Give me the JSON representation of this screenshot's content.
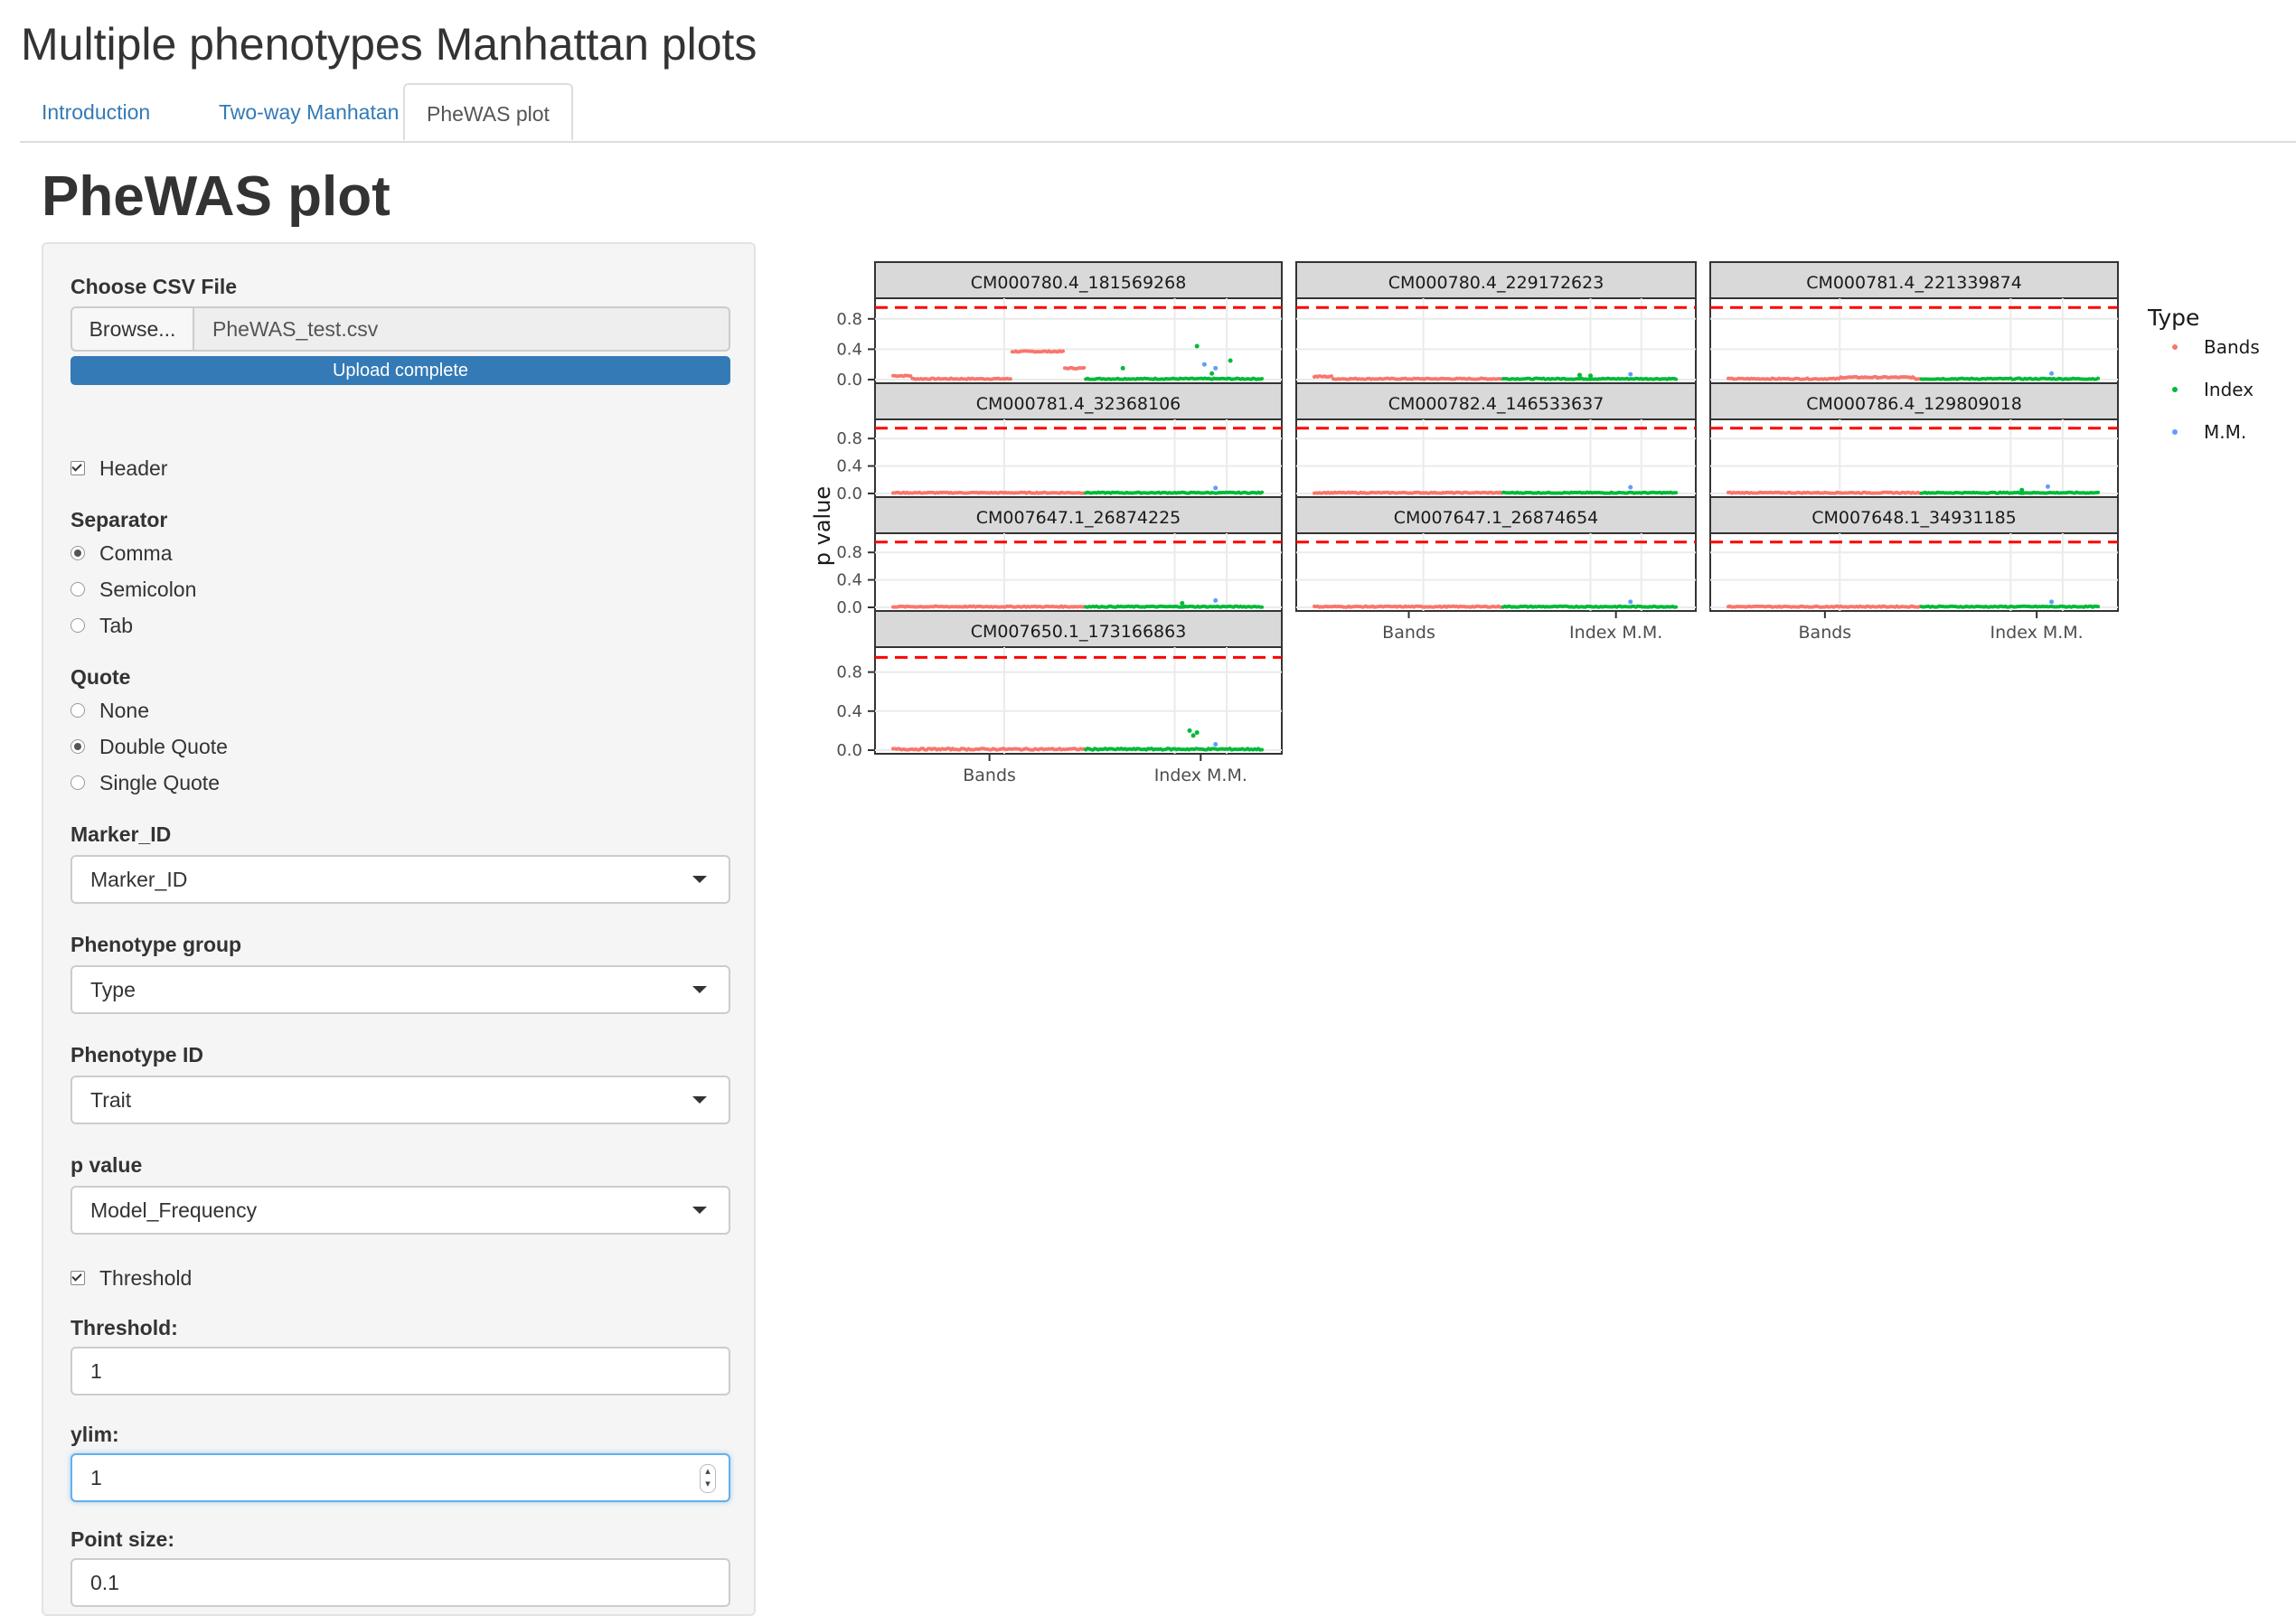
{
  "app": {
    "title": "Multiple phenotypes Manhattan plots",
    "tabs": [
      {
        "label": "Introduction",
        "active": false
      },
      {
        "label": "Two-way Manhatan",
        "active": false
      },
      {
        "label": "PheWAS plot",
        "active": true
      }
    ]
  },
  "page": {
    "title": "PheWAS plot"
  },
  "sidebar": {
    "file": {
      "label": "Choose CSV File",
      "browse_label": "Browse...",
      "file_name": "PheWAS_test.csv",
      "progress_text": "Upload complete",
      "progress": 1.0
    },
    "header_checkbox": {
      "label": "Header",
      "checked": true
    },
    "separator": {
      "label": "Separator",
      "options": [
        {
          "label": "Comma",
          "selected": true
        },
        {
          "label": "Semicolon",
          "selected": false
        },
        {
          "label": "Tab",
          "selected": false
        }
      ]
    },
    "quote": {
      "label": "Quote",
      "options": [
        {
          "label": "None",
          "selected": false
        },
        {
          "label": "Double Quote",
          "selected": true
        },
        {
          "label": "Single Quote",
          "selected": false
        }
      ]
    },
    "marker_id": {
      "label": "Marker_ID",
      "value": "Marker_ID"
    },
    "phenotype_group": {
      "label": "Phenotype group",
      "value": "Type"
    },
    "phenotype_id": {
      "label": "Phenotype ID",
      "value": "Trait"
    },
    "p_value": {
      "label": "p value",
      "value": "Model_Frequency"
    },
    "threshold_checkbox": {
      "label": "Threshold",
      "checked": true
    },
    "threshold": {
      "label": "Threshold:",
      "value": "1"
    },
    "ylim": {
      "label": "ylim:",
      "value": "1"
    },
    "point_size": {
      "label": "Point size:",
      "value": "0.1"
    }
  },
  "colors": {
    "accent": "#337ab7",
    "bands": "#F8766D",
    "index": "#00BA38",
    "mm": "#619CFF",
    "threshold_line": "#FF0000",
    "strip_bg": "#D9D9D9"
  },
  "chart_data": {
    "type": "scatter",
    "title": "",
    "xlabel": "",
    "ylabel": "p value",
    "y_ticks": [
      "0.0",
      "0.4",
      "0.8"
    ],
    "ylim": [
      0,
      1
    ],
    "threshold": 0.95,
    "x_categories": [
      "Bands",
      "Index",
      "M.M."
    ],
    "x_tick_labels": [
      "Bands",
      "Index M.M."
    ],
    "legend": {
      "title": "Type",
      "position": "right",
      "entries": [
        "Bands",
        "Index",
        "M.M."
      ]
    },
    "grid": true,
    "panels": [
      {
        "title": "CM000780.4_181569268",
        "series": [
          {
            "name": "Bands",
            "baseline": 0.01,
            "bumps": [
              {
                "from": 0.0,
                "to": 0.05,
                "value": 0.05
              },
              {
                "from": 0.32,
                "to": 0.46,
                "value": 0.37
              },
              {
                "from": 0.46,
                "to": 0.52,
                "value": 0.15
              }
            ]
          },
          {
            "name": "Index",
            "baseline": 0.01,
            "outliers": [
              [
                0.62,
                0.15
              ],
              [
                0.82,
                0.44
              ],
              [
                0.91,
                0.25
              ],
              [
                0.86,
                0.08
              ]
            ]
          },
          {
            "name": "M.M.",
            "outliers": [
              [
                0.84,
                0.2
              ],
              [
                0.87,
                0.15
              ]
            ]
          }
        ]
      },
      {
        "title": "CM000780.4_229172623",
        "series": [
          {
            "name": "Bands",
            "baseline": 0.01,
            "bumps": [
              {
                "from": 0.0,
                "to": 0.05,
                "value": 0.04
              }
            ]
          },
          {
            "name": "Index",
            "baseline": 0.01,
            "outliers": [
              [
                0.73,
                0.06
              ],
              [
                0.76,
                0.05
              ]
            ]
          },
          {
            "name": "M.M.",
            "outliers": [
              [
                0.87,
                0.07
              ]
            ]
          }
        ]
      },
      {
        "title": "CM000781.4_221339874",
        "series": [
          {
            "name": "Bands",
            "baseline": 0.01,
            "bumps": [
              {
                "from": 0.3,
                "to": 0.5,
                "value": 0.03
              }
            ]
          },
          {
            "name": "Index",
            "baseline": 0.01,
            "outliers": []
          },
          {
            "name": "M.M.",
            "outliers": [
              [
                0.87,
                0.08
              ]
            ]
          }
        ]
      },
      {
        "title": "CM000781.4_32368106",
        "series": [
          {
            "name": "Bands",
            "baseline": 0.01,
            "bumps": []
          },
          {
            "name": "Index",
            "baseline": 0.01,
            "outliers": []
          },
          {
            "name": "M.M.",
            "outliers": [
              [
                0.87,
                0.08
              ]
            ]
          }
        ]
      },
      {
        "title": "CM000782.4_146533637",
        "series": [
          {
            "name": "Bands",
            "baseline": 0.01,
            "bumps": []
          },
          {
            "name": "Index",
            "baseline": 0.01,
            "outliers": []
          },
          {
            "name": "M.M.",
            "outliers": [
              [
                0.87,
                0.09
              ]
            ]
          }
        ]
      },
      {
        "title": "CM000786.4_129809018",
        "series": [
          {
            "name": "Bands",
            "baseline": 0.01,
            "bumps": []
          },
          {
            "name": "Index",
            "baseline": 0.01,
            "outliers": [
              [
                0.79,
                0.05
              ]
            ]
          },
          {
            "name": "M.M.",
            "outliers": [
              [
                0.86,
                0.1
              ]
            ]
          }
        ]
      },
      {
        "title": "CM007647.1_26874225",
        "series": [
          {
            "name": "Bands",
            "baseline": 0.01,
            "bumps": []
          },
          {
            "name": "Index",
            "baseline": 0.01,
            "outliers": [
              [
                0.78,
                0.06
              ]
            ]
          },
          {
            "name": "M.M.",
            "outliers": [
              [
                0.87,
                0.1
              ]
            ]
          }
        ]
      },
      {
        "title": "CM007647.1_26874654",
        "series": [
          {
            "name": "Bands",
            "baseline": 0.01,
            "bumps": []
          },
          {
            "name": "Index",
            "baseline": 0.01,
            "outliers": []
          },
          {
            "name": "M.M.",
            "outliers": [
              [
                0.87,
                0.08
              ]
            ]
          }
        ]
      },
      {
        "title": "CM007648.1_34931185",
        "series": [
          {
            "name": "Bands",
            "baseline": 0.01,
            "bumps": []
          },
          {
            "name": "Index",
            "baseline": 0.01,
            "outliers": []
          },
          {
            "name": "M.M.",
            "outliers": [
              [
                0.87,
                0.08
              ]
            ]
          }
        ]
      },
      {
        "title": "CM007650.1_173166863",
        "series": [
          {
            "name": "Bands",
            "baseline": 0.01,
            "bumps": []
          },
          {
            "name": "Index",
            "baseline": 0.01,
            "outliers": [
              [
                0.8,
                0.2
              ],
              [
                0.81,
                0.15
              ],
              [
                0.82,
                0.18
              ]
            ]
          },
          {
            "name": "M.M.",
            "outliers": [
              [
                0.87,
                0.06
              ]
            ]
          }
        ]
      }
    ]
  }
}
